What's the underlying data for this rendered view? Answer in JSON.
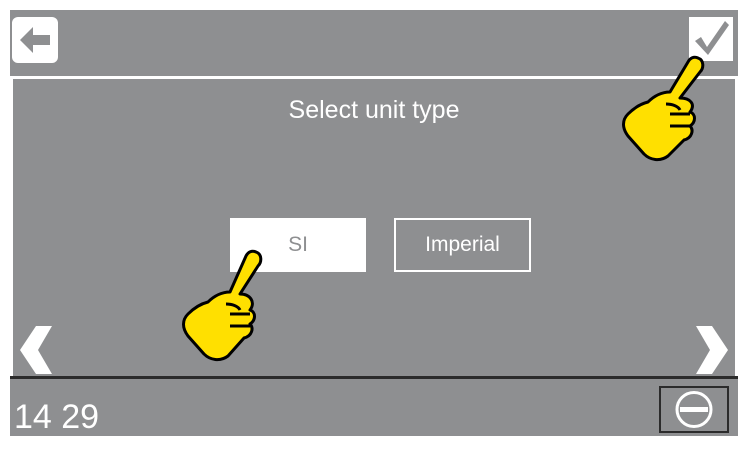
{
  "screen": {
    "title": "Select unit type",
    "time": "14 29"
  },
  "options": [
    {
      "label": "SI",
      "selected": true
    },
    {
      "label": "Imperial",
      "selected": false
    }
  ],
  "icons": {
    "back": "back-arrow-icon",
    "confirm": "checkmark-icon",
    "prev": "chevron-left-icon",
    "next": "chevron-right-icon",
    "stop": "minus-circle-icon",
    "pointer": "pointing-hand-icon"
  },
  "colors": {
    "background": "#8e8f91",
    "foreground": "#ffffff",
    "hand": "#ffe000"
  }
}
